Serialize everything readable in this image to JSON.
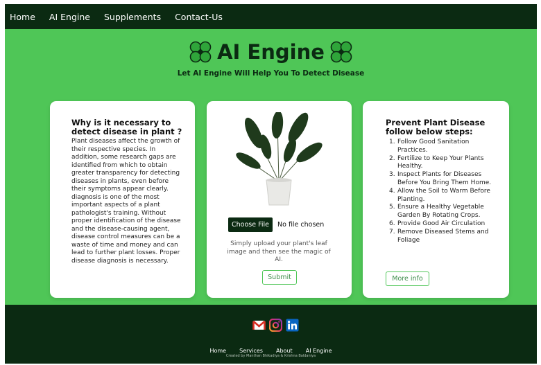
{
  "nav": {
    "links": [
      "Home",
      "AI Engine",
      "Supplements",
      "Contact-Us"
    ]
  },
  "hero": {
    "brand": "AI Engine",
    "subtitle": "Let AI Engine Will Help You To Detect Disease"
  },
  "info_card": {
    "title": "Why is it necessary to detect disease in plant ?",
    "body": "Plant diseases affect the growth of their respective species. In addition, some research gaps are identified from which to obtain greater transparency for detecting diseases in plants, even before their symptoms appear clearly. diagnosis is one of the most important aspects of a plant pathologist's training. Without proper identification of the disease and the disease-causing agent, disease control measures can be a waste of time and money and can lead to further plant losses. Proper disease diagnosis is necessary."
  },
  "upload_card": {
    "choose_file_label": "Choose File",
    "file_status": "No file chosen",
    "hint": "Simply upload your plant's leaf image and then see the magic of AI.",
    "submit_label": "Submit"
  },
  "prevent_card": {
    "title": "Prevent Plant Disease follow below steps:",
    "steps": [
      "Follow Good Sanitation Practices.",
      "Fertilize to Keep Your Plants Healthy.",
      "Inspect Plants for Diseases Before You Bring Them Home.",
      "Allow the Soil to Warm Before Planting.",
      "Ensure a Healthy Vegetable Garden By Rotating Crops.",
      "Provide Good Air Circulation",
      "Remove Diseased Stems and Foliage"
    ],
    "more_label": "More info"
  },
  "footer": {
    "social_icons": [
      "gmail-icon",
      "instagram-icon",
      "linkedin-icon"
    ],
    "links": [
      "Home",
      "Services",
      "About",
      "AI Engine"
    ],
    "credit": "Created by Manthan Bhikadiya & Krishna Baldaniya"
  },
  "colors": {
    "accent": "#4fc657",
    "dark": "#0b2a12"
  }
}
